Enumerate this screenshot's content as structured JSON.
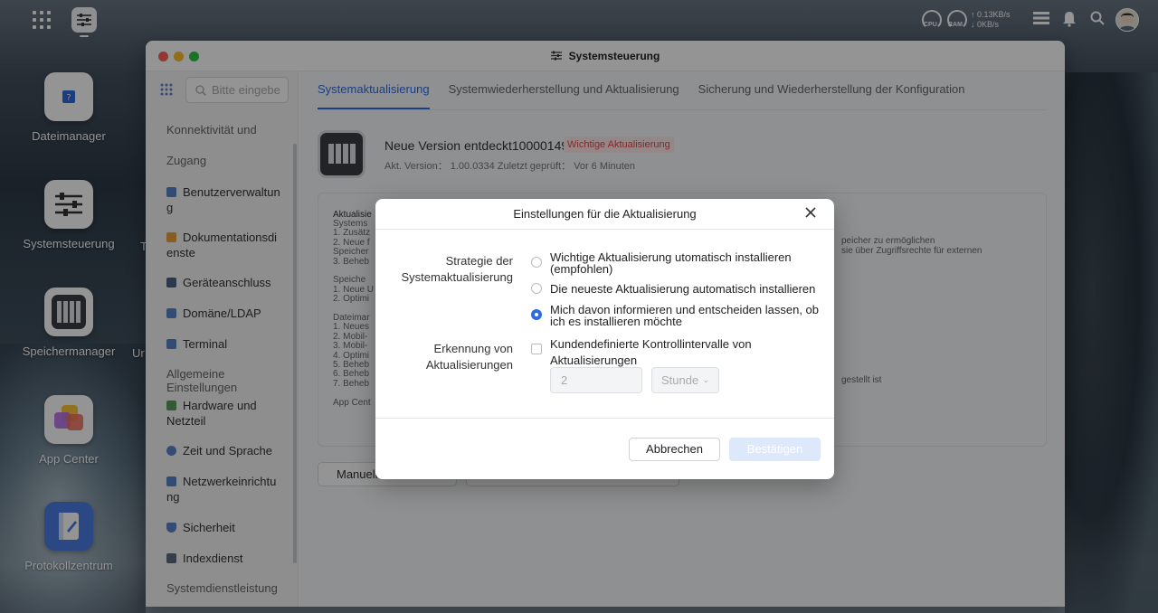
{
  "topbar": {
    "cpu_label": "CPU",
    "ram_label": "RAM",
    "net_up": "↑ 0.13KB/s",
    "net_down": "↓ 0KB/s"
  },
  "desktop": {
    "icons": [
      {
        "label": "Dateimanager"
      },
      {
        "label": "Systemsteuerung"
      },
      {
        "label": "Speichermanager"
      },
      {
        "label": "App Center"
      },
      {
        "label": "Protokollzentrum"
      }
    ],
    "partial_labels": [
      "T",
      "Ur"
    ]
  },
  "window": {
    "title": "Systemsteuerung"
  },
  "sidebar": {
    "search_placeholder": "Bitte eingebe",
    "items": [
      {
        "label": "Konnektivität und",
        "type": "section"
      },
      {
        "label": "Zugang",
        "type": "section"
      },
      {
        "label": "Benutzerverwaltun g",
        "type": "item"
      },
      {
        "label": "Dokumentationsdi enste",
        "type": "item"
      },
      {
        "label": "Geräteanschluss",
        "type": "item"
      },
      {
        "label": "Domäne/LDAP",
        "type": "item"
      },
      {
        "label": "Terminal",
        "type": "item"
      },
      {
        "label": "Allgemeine Einstellungen",
        "type": "section"
      },
      {
        "label": "Hardware und Netzteil",
        "type": "item"
      },
      {
        "label": "Zeit und Sprache",
        "type": "item"
      },
      {
        "label": "Netzwerkeinrichtu ng",
        "type": "item"
      },
      {
        "label": "Sicherheit",
        "type": "item"
      },
      {
        "label": "Indexdienst",
        "type": "item"
      },
      {
        "label": "Systemdienstleistung",
        "type": "section"
      }
    ]
  },
  "main": {
    "tabs": [
      {
        "label": "Systemaktualisierung",
        "active": true
      },
      {
        "label": "Systemwiederherstellung und Aktualisierung",
        "active": false
      },
      {
        "label": "Sicherung und Wiederherstellung der Konfiguration",
        "active": false
      }
    ],
    "version_title": "Neue Version entdeckt100001494",
    "badge": "Wichtige Aktualisierung",
    "version_sub": "Akt. Version： 1.00.0334    Zuletzt geprüft： Vor 6 Minuten",
    "card_lines": [
      "Aktualisie",
      "Systems",
      "1. Zusätz",
      "2. Neue f",
      "Speicher",
      "3. Beheb",
      "",
      "Speiche",
      "1. Neue U",
      "2. Optimi",
      "",
      "Dateimar",
      "1. Neues",
      "2. Mobil-",
      "3. Mobil-",
      "4. Optimi",
      "5. Beheb",
      "6. Beheb",
      "7. Beheb",
      "",
      "App Cent"
    ],
    "card_right": [
      "peicher zu ermöglichen",
      "sie über Zugriffsrechte für externen",
      "gestellt ist"
    ],
    "manual_button": "Manuell"
  },
  "dialog": {
    "title": "Einstellungen für die Aktualisierung",
    "strategy_label": "Strategie der Systemaktualisierung",
    "options": [
      {
        "label": "Wichtige Aktualisierung utomatisch installieren (empfohlen)",
        "selected": false
      },
      {
        "label": "Die neueste Aktualisierung automatisch installieren",
        "selected": false
      },
      {
        "label": "Mich davon informieren und entscheiden lassen, ob ich es installieren möchte",
        "selected": true
      }
    ],
    "detection_label": "Erkennung von Aktualisierungen",
    "custom_interval_label": "Kundendefinierte Kontrollintervalle von Aktualisierungen",
    "custom_interval_checked": false,
    "interval_value": "2",
    "interval_unit": "Stunde",
    "cancel_label": "Abbrechen",
    "confirm_label": "Bestätigen"
  },
  "colors": {
    "accent": "#2d6be0",
    "badge_red": "#e5484d",
    "confirm_disabled_bg": "#dde8fb"
  }
}
